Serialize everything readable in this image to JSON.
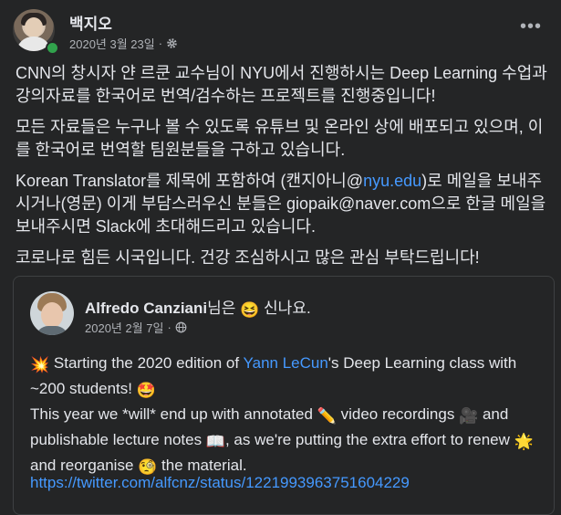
{
  "post": {
    "author": "백지오",
    "date": "2020년 3월 23일",
    "separator": "·",
    "more_label": "•••",
    "paragraphs": {
      "p1": "CNN의 창시자 얀 르쿤 교수님이 NYU에서 진행하시는 Deep Learning 수업과 강의자료를 한국어로 번역/검수하는 프로젝트를 진행중입니다!",
      "p2": "모든 자료들은 누구나 볼 수 있도록 유튜브 및 온라인 상에 배포되고 있으며, 이를 한국어로 번역할 팀원분들을 구하고 있습니다.",
      "p3_a": "Korean Translator를 제목에 포함하여 (캔지아니@",
      "p3_link": "nyu.edu",
      "p3_b": ")로 메일을 보내주시거나(영문) 이게 부담스러우신 분들은 giopaik@naver.com으로 한글  메일을 보내주시면 Slack에 초대해드리고 있습니다.",
      "p4": "코로나로 힘든 시국입니다. 건강 조심하시고 많은 관심 부탁드립니다!"
    }
  },
  "shared": {
    "author_name": "Alfredo Canziani",
    "author_suffix": "님은",
    "feeling": "신나요.",
    "feeling_emoji": "😆",
    "date": "2020년 2월 7일",
    "separator": "·",
    "line1_emoji": "💥",
    "line1_a": "Starting the 2020 edition of ",
    "line1_link": "Yann LeCun",
    "line1_b": "'s Deep Learning class with ~200 students! ",
    "line1_emoji2": "🤩",
    "line2_a": "This year we *will* end up with annotated ",
    "line2_emoji1": "✏️",
    "line2_b": " video recordings ",
    "line2_emoji2": "🎥",
    "line2_c": " and publishable lecture notes ",
    "line2_emoji3": "📖",
    "line2_d": ", as we're putting the extra effort to renew ",
    "line2_emoji4": "🌟",
    "line2_e": " and reorganise ",
    "line2_emoji5": "🧐",
    "line2_f": " the material.",
    "url": "https://twitter.com/alfcnz/status/1221993963751604229"
  },
  "icons": {
    "privacy": "gear-icon",
    "shared_privacy": "globe-icon",
    "more": "more-options-icon"
  },
  "colors": {
    "background": "#242526",
    "text": "#e4e6eb",
    "muted": "#b0b3b8",
    "link": "#4599ff",
    "online": "#31a24c"
  }
}
